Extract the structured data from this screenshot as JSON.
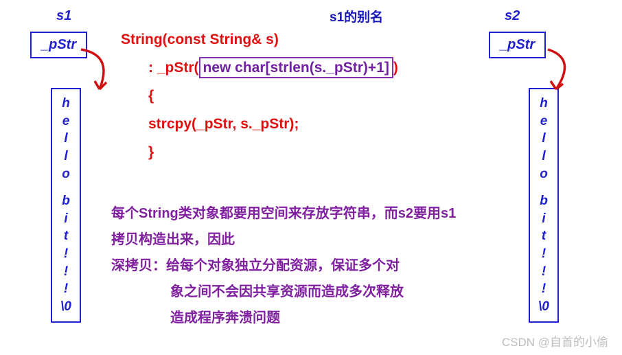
{
  "s1_label": "s1",
  "s2_label": "s2",
  "alias_label": "s1的别名",
  "pstr_text": "_pStr",
  "string_chars": [
    "h",
    "e",
    "l",
    "l",
    "o",
    "",
    "b",
    "i",
    "t",
    "!",
    "!",
    "!",
    "\\0"
  ],
  "code": {
    "line1_a": "String(const String& s)",
    "line2_a": ": _pStr(",
    "line2_b": "new char[strlen(s._pStr)+1]",
    "line2_c": ")",
    "line3": "{",
    "line4": "strcpy(_pStr, s._pStr);",
    "line5": "}"
  },
  "explain": {
    "p1": "每个String类对象都要用空间来存放字符串，而s2要用s1拷贝构造出来，因此",
    "p2a": "深拷贝：给每个对象独立分配资源，保证多个对",
    "p2b": "象之间不会因共享资源而造成多次释放",
    "p2c": "造成程序奔溃问题"
  },
  "watermark": "CSDN @自首的小偷",
  "truncated_top": "…………………"
}
